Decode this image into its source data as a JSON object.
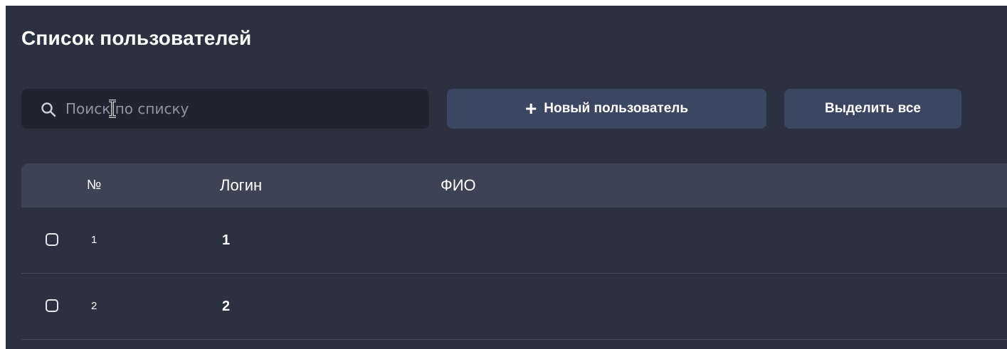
{
  "page": {
    "title": "Список пользователей"
  },
  "toolbar": {
    "search_placeholder": "Поиск по списку",
    "search_value": "",
    "new_user_icon": "+",
    "new_user_label": "Новый пользователь",
    "select_all_label": "Выделить все"
  },
  "icons": {
    "search": "search-icon",
    "cursor": "text-cursor-icon",
    "new_user": "plus-icon"
  },
  "table": {
    "columns": [
      {
        "key": "num",
        "label": "№"
      },
      {
        "key": "login",
        "label": "Логин"
      },
      {
        "key": "fio",
        "label": "ФИО"
      }
    ],
    "rows": [
      {
        "num": "1",
        "login": "1",
        "fio": "",
        "checked": false
      },
      {
        "num": "2",
        "login": "2",
        "fio": "",
        "checked": false
      }
    ]
  },
  "colors": {
    "background": "#2b3140",
    "search_bg": "#1f2430",
    "button_bg": "#3b4660",
    "header_bg": "#3c4354",
    "row_divider": "#434a5b",
    "text": "#ffffff",
    "placeholder": "#8e95a3"
  }
}
